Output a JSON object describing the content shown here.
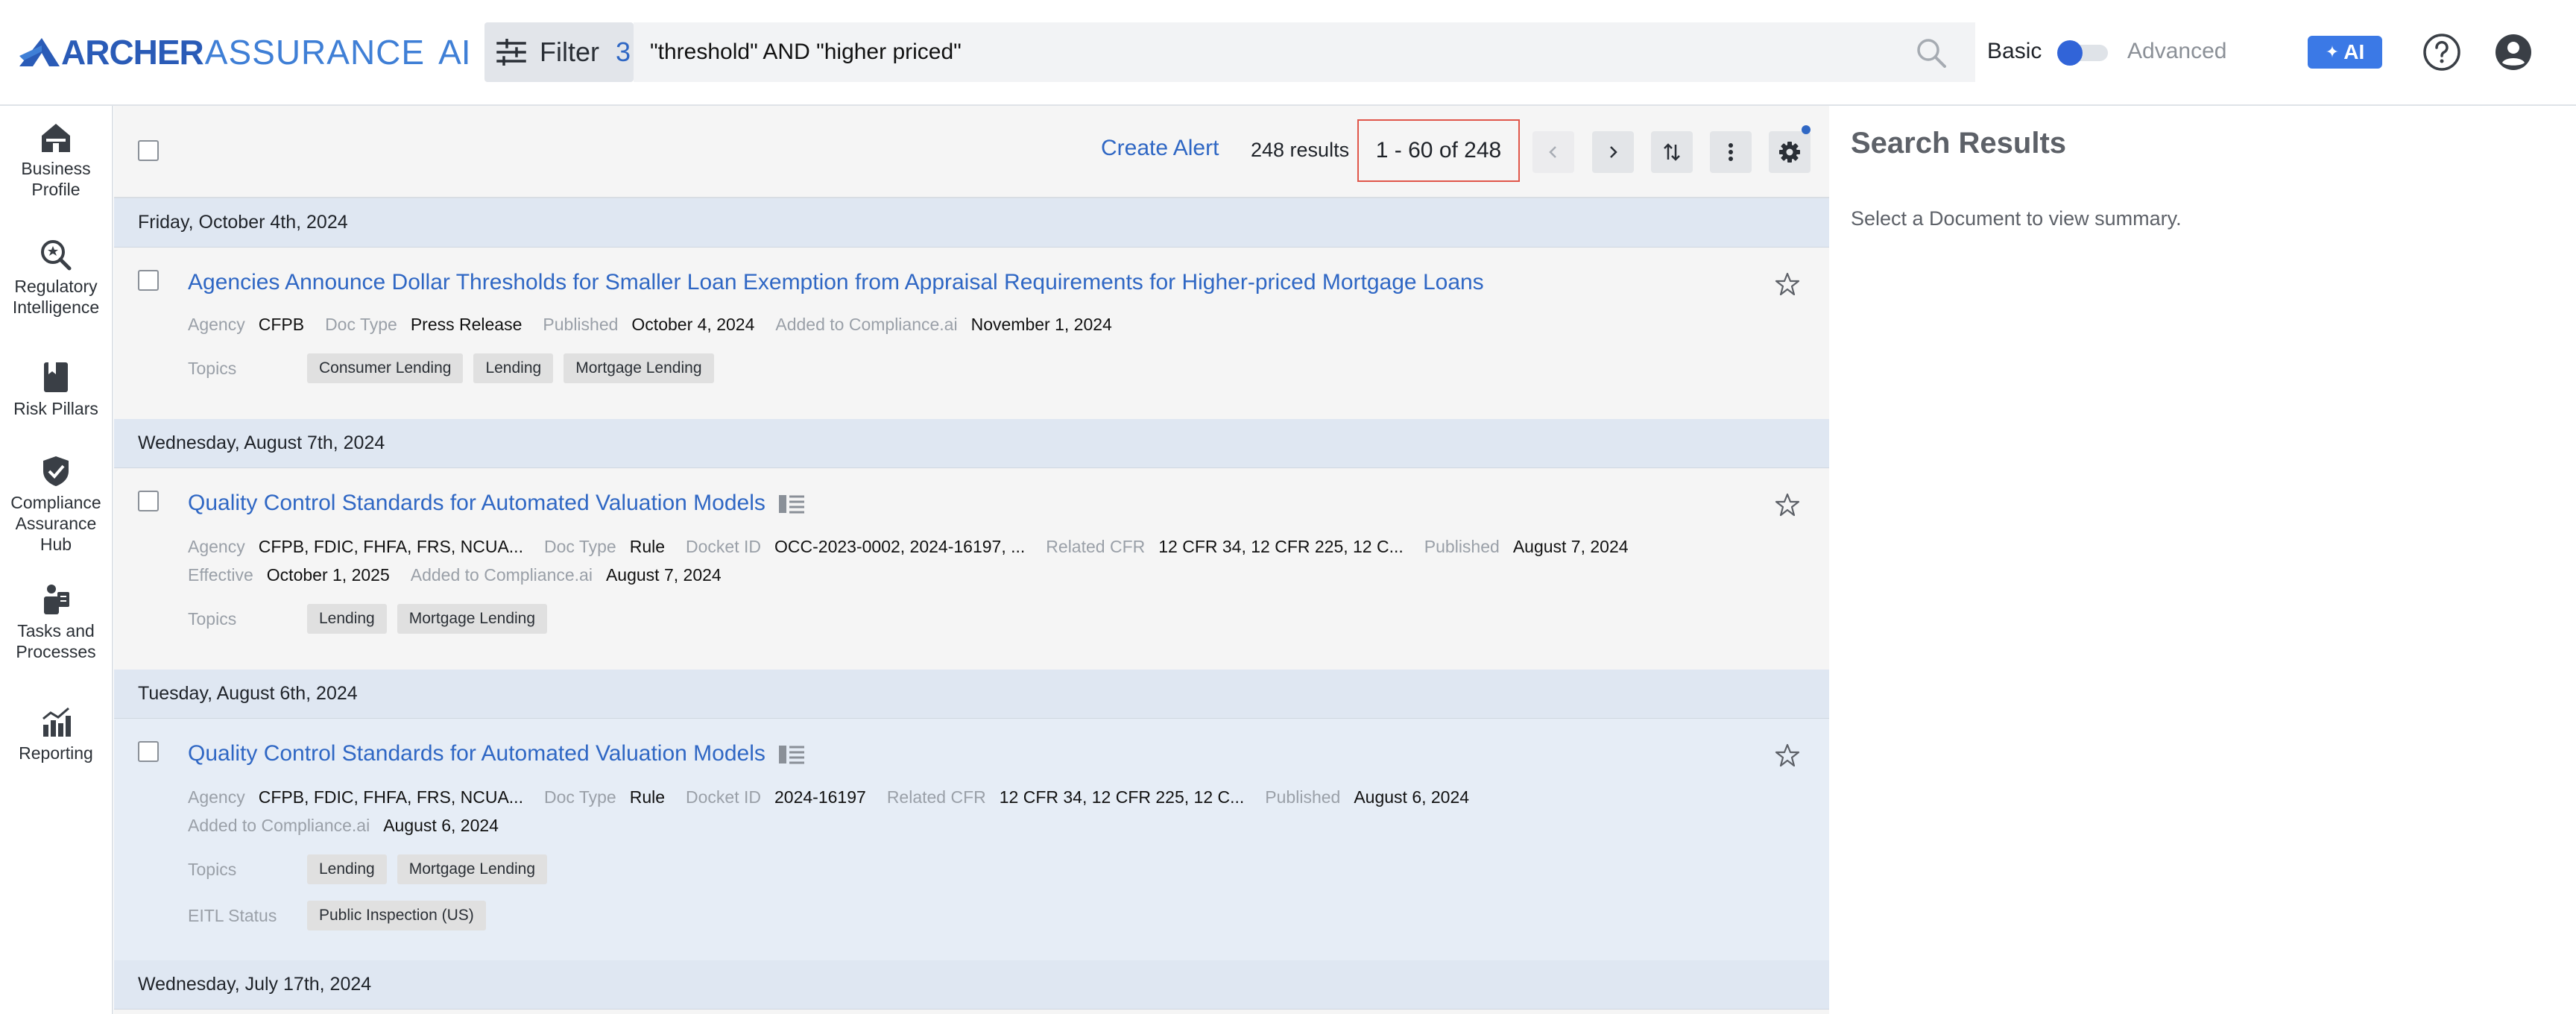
{
  "header": {
    "logo": {
      "part1": "ARCHER",
      "part2": "ASSURANCE",
      "part3": "AI"
    },
    "filter": {
      "label": "Filter",
      "count": "3"
    },
    "search": {
      "value": "\"threshold\" AND \"higher priced\""
    },
    "mode": {
      "basic": "Basic",
      "advanced": "Advanced"
    },
    "ai_button": "AI",
    "accent_color": "#3164d8"
  },
  "sidebar": {
    "items": [
      {
        "label_line1": "Business",
        "label_line2": "Profile",
        "icon": "business-profile-icon"
      },
      {
        "label_line1": "Regulatory",
        "label_line2": "Intelligence",
        "icon": "regulatory-search-icon"
      },
      {
        "label_line1": "Risk Pillars",
        "label_line2": "",
        "icon": "risk-pillars-icon"
      },
      {
        "label_line1": "Compliance",
        "label_line2": "Assurance",
        "label_line3": "Hub",
        "icon": "shield-check-icon"
      },
      {
        "label_line1": "Tasks and",
        "label_line2": "Processes",
        "icon": "tasks-icon"
      },
      {
        "label_line1": "Reporting",
        "label_line2": "",
        "icon": "reporting-chart-icon"
      }
    ]
  },
  "toolbar": {
    "create_alert": "Create Alert",
    "result_count": "248 results",
    "page_range": "1 - 60 of 248"
  },
  "results": [
    {
      "date": "Friday, October 4th, 2024",
      "title": "Agencies Announce Dollar Thresholds for Smaller Loan Exemption from Appraisal Requirements for Higher-priced Mortgage Loans",
      "meta1": [
        {
          "k": "Agency",
          "v": "CFPB"
        },
        {
          "k": "Doc Type",
          "v": "Press Release"
        },
        {
          "k": "Published",
          "v": "October 4, 2024"
        },
        {
          "k": "Added to Compliance.ai",
          "v": "November 1, 2024"
        }
      ],
      "topics_label": "Topics",
      "topics": [
        "Consumer Lending",
        "Lending",
        "Mortgage Lending"
      ]
    },
    {
      "date": "Wednesday, August 7th, 2024",
      "title": "Quality Control Standards for Automated Valuation Models",
      "meta1": [
        {
          "k": "Agency",
          "v": "CFPB, FDIC, FHFA, FRS, NCUA..."
        },
        {
          "k": "Doc Type",
          "v": "Rule"
        },
        {
          "k": "Docket ID",
          "v": "OCC-2023-0002, 2024-16197, ..."
        },
        {
          "k": "Related CFR",
          "v": "12 CFR 34, 12 CFR 225, 12 C..."
        },
        {
          "k": "Published",
          "v": "August 7, 2024"
        }
      ],
      "meta2": [
        {
          "k": "Effective",
          "v": "October 1, 2025"
        },
        {
          "k": "Added to Compliance.ai",
          "v": "August 7, 2024"
        }
      ],
      "topics_label": "Topics",
      "topics": [
        "Lending",
        "Mortgage Lending"
      ]
    },
    {
      "date": "Tuesday, August 6th, 2024",
      "title": "Quality Control Standards for Automated Valuation Models",
      "meta1": [
        {
          "k": "Agency",
          "v": "CFPB, FDIC, FHFA, FRS, NCUA..."
        },
        {
          "k": "Doc Type",
          "v": "Rule"
        },
        {
          "k": "Docket ID",
          "v": "2024-16197"
        },
        {
          "k": "Related CFR",
          "v": "12 CFR 34, 12 CFR 225, 12 C..."
        },
        {
          "k": "Published",
          "v": "August 6, 2024"
        }
      ],
      "meta2": [
        {
          "k": "Added to Compliance.ai",
          "v": "August 6, 2024"
        }
      ],
      "topics_label": "Topics",
      "topics": [
        "Lending",
        "Mortgage Lending"
      ],
      "eitl_label": "EITL Status",
      "eitl": "Public Inspection (US)"
    },
    {
      "date": "Wednesday, July 17th, 2024"
    }
  ],
  "right_panel": {
    "title": "Search Results",
    "subtitle": "Select a Document to view summary."
  }
}
